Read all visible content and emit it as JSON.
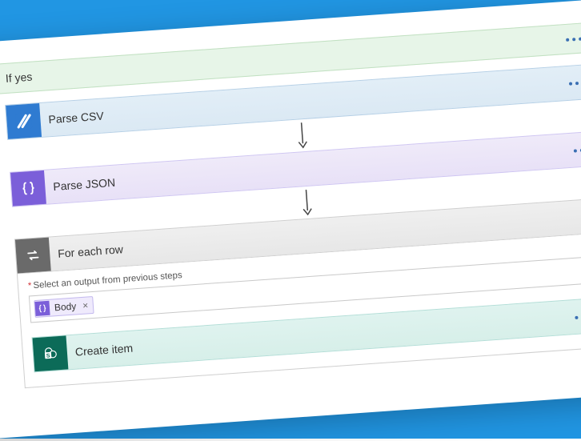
{
  "condition": {
    "branch_label": "If yes"
  },
  "actions": {
    "parse_csv": {
      "title": "Parse CSV"
    },
    "parse_json": {
      "title": "Parse JSON"
    },
    "foreach": {
      "title": "For each row",
      "select_label": "Select an output from previous steps",
      "token_label": "Body"
    },
    "create_item": {
      "title": "Create item"
    }
  },
  "glyph": {
    "close": "×",
    "asterisk": "*"
  }
}
